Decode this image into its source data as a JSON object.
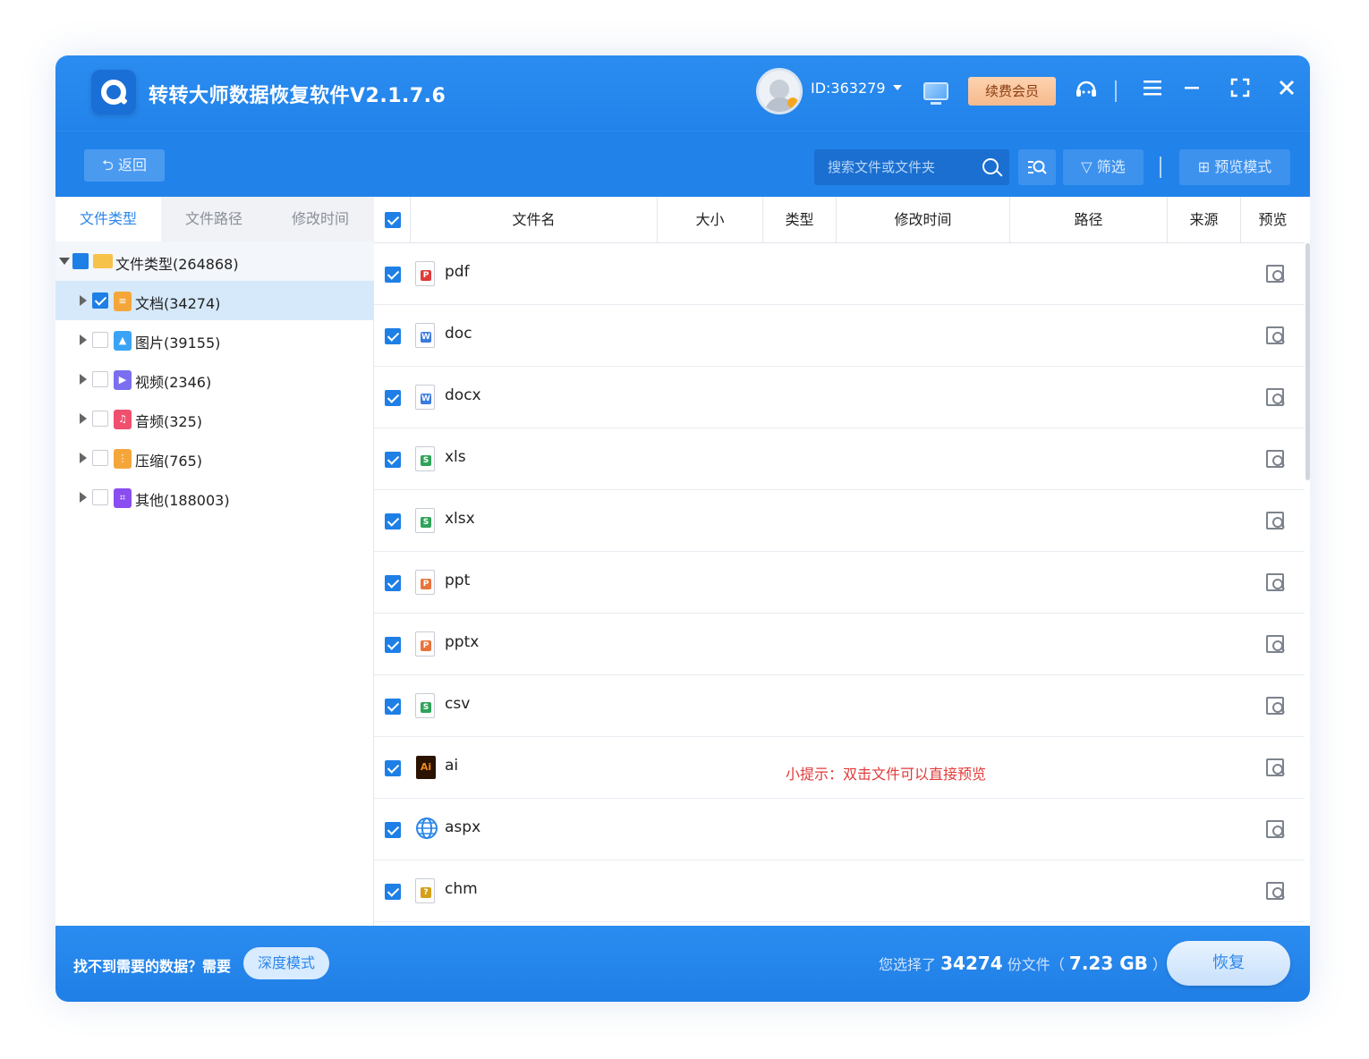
{
  "app": {
    "title": "转转大师数据恢复软件V2.1.7.6",
    "user_id": "ID:363279",
    "vip_label": "续费会员"
  },
  "toolbar": {
    "back_label": "返回",
    "search_placeholder": "搜索文件或文件夹",
    "filter_label": "筛选",
    "preview_mode_label": "预览模式"
  },
  "left_tabs": [
    "文件类型",
    "文件路径",
    "修改时间"
  ],
  "tree": {
    "root": {
      "label": "文件类型(264868)",
      "checked": "partial"
    },
    "items": [
      {
        "label": "文档(34274)",
        "checked": true,
        "selected": true,
        "icon": "document-icon",
        "color": "#f5a63a"
      },
      {
        "label": "图片(39155)",
        "checked": false,
        "icon": "image-icon",
        "color": "#3aa3f5"
      },
      {
        "label": "视频(2346)",
        "checked": false,
        "icon": "video-icon",
        "color": "#7b6ff0"
      },
      {
        "label": "音频(325)",
        "checked": false,
        "icon": "audio-icon",
        "color": "#f0506e"
      },
      {
        "label": "压缩(765)",
        "checked": false,
        "icon": "archive-icon",
        "color": "#f5a63a"
      },
      {
        "label": "其他(188003)",
        "checked": false,
        "icon": "other-icon",
        "color": "#8a4df0"
      }
    ]
  },
  "table": {
    "columns": [
      "文件名",
      "大小",
      "类型",
      "修改时间",
      "路径",
      "来源",
      "预览"
    ],
    "rows": [
      {
        "name": "pdf",
        "icon": "pdf-icon",
        "color": "#e03b3b",
        "mark": "P"
      },
      {
        "name": "doc",
        "icon": "word-icon",
        "color": "#3b7ae0",
        "mark": "W"
      },
      {
        "name": "docx",
        "icon": "word-icon",
        "color": "#3b7ae0",
        "mark": "W"
      },
      {
        "name": "xls",
        "icon": "excel-icon",
        "color": "#2fa35a",
        "mark": "S"
      },
      {
        "name": "xlsx",
        "icon": "excel-icon",
        "color": "#2fa35a",
        "mark": "S"
      },
      {
        "name": "ppt",
        "icon": "powerpoint-icon",
        "color": "#e8743b",
        "mark": "P"
      },
      {
        "name": "pptx",
        "icon": "powerpoint-icon",
        "color": "#e8743b",
        "mark": "P"
      },
      {
        "name": "csv",
        "icon": "csv-icon",
        "color": "#2fa35a",
        "mark": "S"
      },
      {
        "name": "ai",
        "icon": "illustrator-icon",
        "color": "#f08a1c",
        "mark": "Ai"
      },
      {
        "name": "aspx",
        "icon": "globe-icon",
        "color": "#2b86ea",
        "mark": ""
      },
      {
        "name": "chm",
        "icon": "help-file-icon",
        "color": "#d4a017",
        "mark": "?"
      }
    ]
  },
  "tip": "小提示：双击文件可以直接预览",
  "bottom": {
    "prompt": "找不到需要的数据？需要",
    "deep_mode_label": "深度模式",
    "selected_prefix": "您选择了",
    "selected_count": "34274",
    "selected_mid": "份文件（",
    "selected_size": "7.23 GB",
    "selected_suffix": "）",
    "recover_label": "恢复"
  }
}
